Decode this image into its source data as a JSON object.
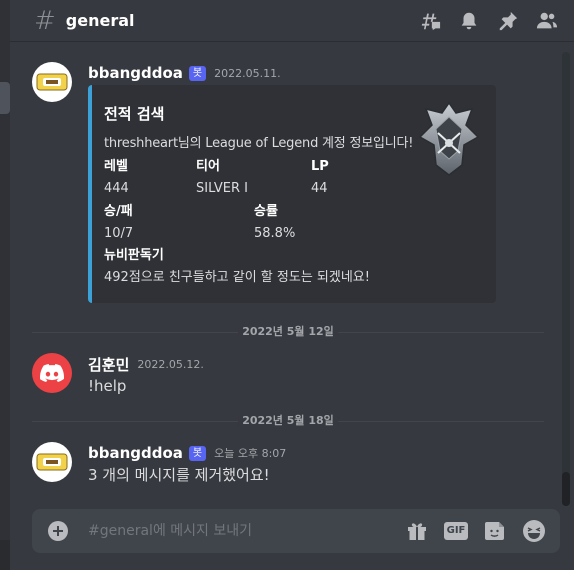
{
  "header": {
    "channel_name": "general",
    "icons": [
      "threads-icon",
      "bell-icon",
      "pin-icon",
      "members-icon"
    ]
  },
  "messages": [
    {
      "username": "bbangddoa",
      "bot_tag": "봇",
      "timestamp": "2022.05.11.",
      "embed": {
        "title": "전적 검색",
        "description": "threshheart님의 League of Legend 계정 정보입니다!",
        "fields": [
          {
            "name": "레벨",
            "value": "444"
          },
          {
            "name": "티어",
            "value": "SILVER I"
          },
          {
            "name": "LP",
            "value": "44"
          },
          {
            "name": "승/패",
            "value": "10/7"
          },
          {
            "name": "승률",
            "value": "58.8%"
          },
          {
            "name": "뉴비판독기",
            "value": "492점으로 친구들하고 같이 할 정도는 되겠네요!"
          }
        ],
        "accent_color": "#3ba1d6"
      }
    },
    {
      "username": "김훈민",
      "timestamp": "2022.05.12.",
      "text": "!help"
    },
    {
      "username": "bbangddoa",
      "bot_tag": "봇",
      "timestamp": "오늘 오후 8:07",
      "text": "3 개의 메시지를 제거했어요!"
    }
  ],
  "dividers": [
    "2022년 5월 12일",
    "2022년 5월 18일"
  ],
  "input": {
    "placeholder": "#general에 메시지 보내기",
    "gif_label": "GIF"
  },
  "colors": {
    "background": "#36393f",
    "embed_background": "#2f3136",
    "bot_tag": "#5865f2",
    "discord_red": "#ed4245"
  }
}
